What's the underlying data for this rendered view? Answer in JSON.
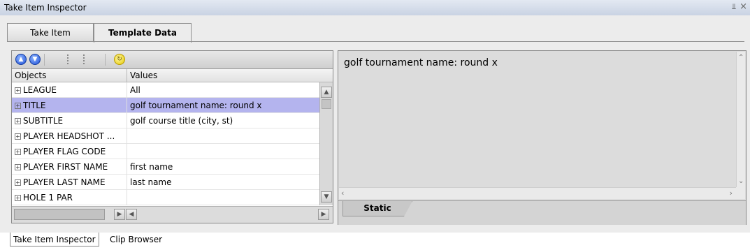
{
  "window": {
    "title": "Take Item Inspector",
    "pin_glyph": "⫫",
    "close_glyph": "×"
  },
  "tabs": [
    {
      "label": "Take Item"
    },
    {
      "label": "Template Data"
    }
  ],
  "toolbar": {
    "icons": [
      "move-up-icon",
      "move-down-icon",
      "tree-expand-icon",
      "tree-collapse-icon",
      "refresh-icon"
    ]
  },
  "grid": {
    "headers": {
      "objects": "Objects",
      "values": "Values"
    },
    "rows": [
      {
        "object": "LEAGUE",
        "value": "All"
      },
      {
        "object": "TITLE",
        "value": "golf tournament name: round x",
        "selected": true
      },
      {
        "object": "SUBTITLE",
        "value": "golf course title (city, st)"
      },
      {
        "object": "PLAYER HEADSHOT ...",
        "value": ""
      },
      {
        "object": "PLAYER FLAG CODE",
        "value": ""
      },
      {
        "object": "PLAYER FIRST NAME",
        "value": "first name"
      },
      {
        "object": "PLAYER LAST NAME",
        "value": "last name"
      },
      {
        "object": "HOLE 1 PAR",
        "value": ""
      }
    ]
  },
  "editor": {
    "text": "golf tournament name: round x"
  },
  "right_tabs": [
    {
      "label": "Static"
    }
  ],
  "bottom_tabs": [
    {
      "label": "Take Item Inspector"
    },
    {
      "label": "Clip Browser"
    }
  ],
  "colors": {
    "selection": "#b4b4ee",
    "panel": "#ececec"
  }
}
